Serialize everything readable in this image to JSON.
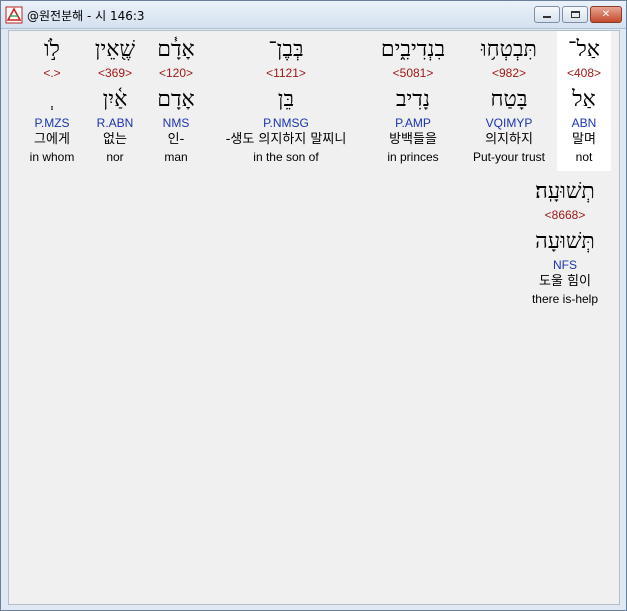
{
  "window": {
    "title": "@원전분해 - 시 146:3"
  },
  "words": [
    {
      "heb": "לֹ֣ו",
      "strong": "<.>",
      "lemma": "ְ",
      "morph": "P.MZS",
      "kor": "그에게",
      "eng": "in whom"
    },
    {
      "heb": "שֶׁ֖אֵין",
      "strong": "<369>",
      "lemma": "אַ֫יִן",
      "morph": "R.ABN",
      "kor": "없는",
      "eng": "nor"
    },
    {
      "heb": "אָדָ֓ם",
      "strong": "<120>",
      "lemma": "אָדָם",
      "morph": "NMS",
      "kor": "인-",
      "eng": "man"
    },
    {
      "heb": "בְּבֶן־",
      "strong": "<1121>",
      "lemma": "בֵּן",
      "morph": "P.NMSG",
      "kor": "-생도 의지하지 말찌니",
      "eng": "in the son of"
    },
    {
      "heb": "בִנְדִיבִ֑ים",
      "strong": "<5081>",
      "lemma": "נָדִיב",
      "morph": "P.AMP",
      "kor": "방백들을",
      "eng": "in princes"
    },
    {
      "heb": "תִּבְטְח֥וּ",
      "strong": "<982>",
      "lemma": "בָּטַח",
      "morph": "VQIMYP",
      "kor": "의지하지",
      "eng": "Put-your trust"
    },
    {
      "heb": "אַל־",
      "strong": "<408>",
      "lemma": "אַל",
      "morph": "ABN",
      "kor": "말며",
      "eng": "not"
    },
    {
      "heb": "תְשׁוּעָֽה׃",
      "strong": "<8668>",
      "lemma": "תְּשׁוּעָה",
      "morph": "NFS",
      "kor": "도울 힘이",
      "eng": "there is-help"
    }
  ]
}
